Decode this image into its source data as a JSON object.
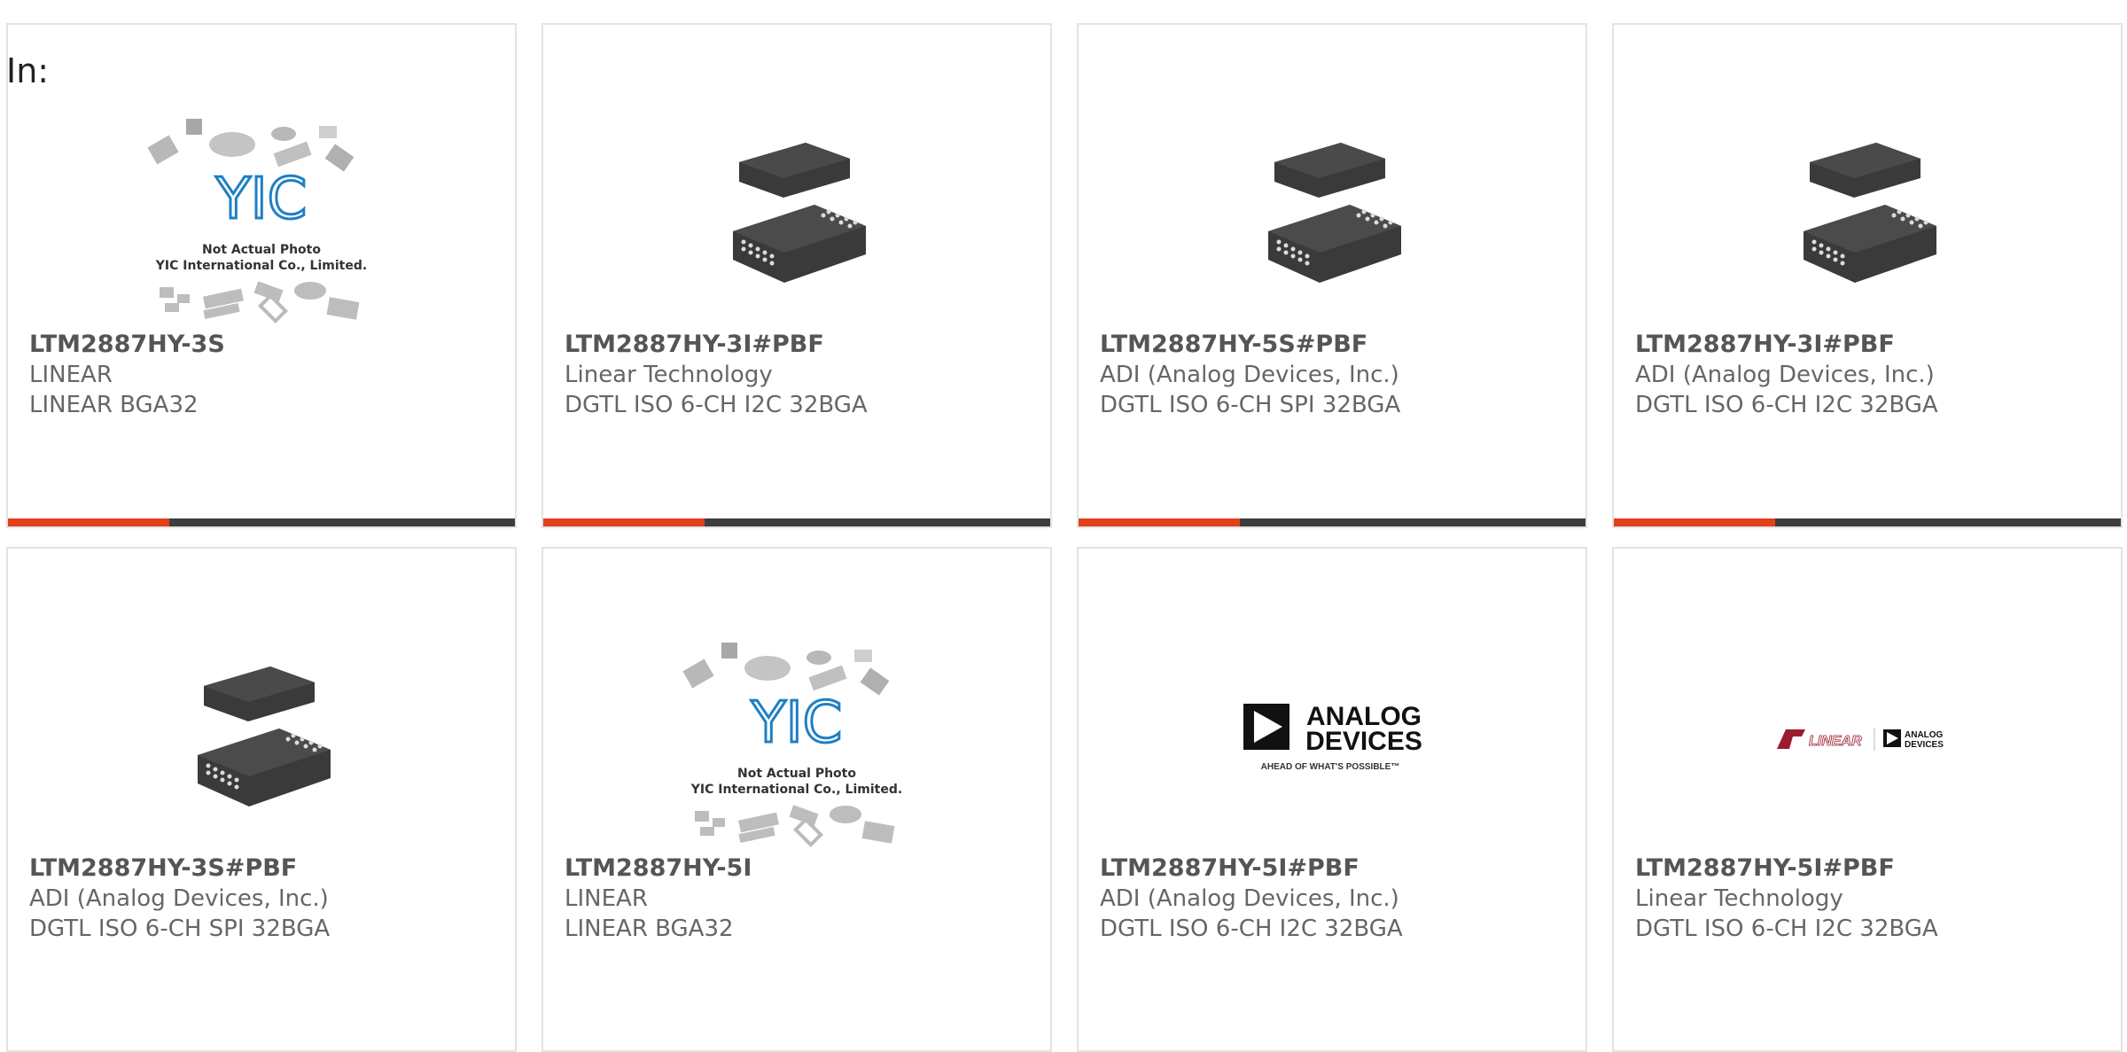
{
  "header": {
    "label": "In:"
  },
  "placeholder": {
    "brand": "YIC",
    "note1": "Not Actual Photo",
    "note2": "YIC International Co., Limited."
  },
  "logos": {
    "adi_line1": "ANALOG",
    "adi_line2": "DEVICES",
    "adi_tagline": "AHEAD OF WHAT'S POSSIBLE™",
    "lt_text": "LINEAR",
    "lt_sub1": "ANALOG",
    "lt_sub2": "DEVICES"
  },
  "colors": {
    "accent": "#e2401c",
    "bar": "#3d3d3d",
    "chip": "#3a3a3a",
    "yic_blue": "#1f7fc4"
  },
  "products": [
    {
      "part": "LTM2887HY-3S",
      "maker": "LINEAR",
      "desc": "LINEAR BGA32",
      "image": "placeholder-photo"
    },
    {
      "part": "LTM2887HY-3I#PBF",
      "maker": "Linear Technology",
      "desc": "DGTL ISO 6-CH I2C 32BGA",
      "image": "bga-chip"
    },
    {
      "part": "LTM2887HY-5S#PBF",
      "maker": "ADI (Analog Devices, Inc.)",
      "desc": "DGTL ISO 6-CH SPI 32BGA",
      "image": "bga-chip"
    },
    {
      "part": "LTM2887HY-3I#PBF",
      "maker": "ADI (Analog Devices, Inc.)",
      "desc": "DGTL ISO 6-CH I2C 32BGA",
      "image": "bga-chip"
    },
    {
      "part": "LTM2887HY-3S#PBF",
      "maker": "ADI (Analog Devices, Inc.)",
      "desc": "DGTL ISO 6-CH SPI 32BGA",
      "image": "bga-chip"
    },
    {
      "part": "LTM2887HY-5I",
      "maker": "LINEAR",
      "desc": "LINEAR BGA32",
      "image": "placeholder-photo"
    },
    {
      "part": "LTM2887HY-5I#PBF",
      "maker": "ADI (Analog Devices, Inc.)",
      "desc": "DGTL ISO 6-CH I2C 32BGA",
      "image": "analog-devices-logo"
    },
    {
      "part": "LTM2887HY-5I#PBF",
      "maker": "Linear Technology",
      "desc": "DGTL ISO 6-CH I2C 32BGA",
      "image": "linear-adi-logo"
    }
  ]
}
